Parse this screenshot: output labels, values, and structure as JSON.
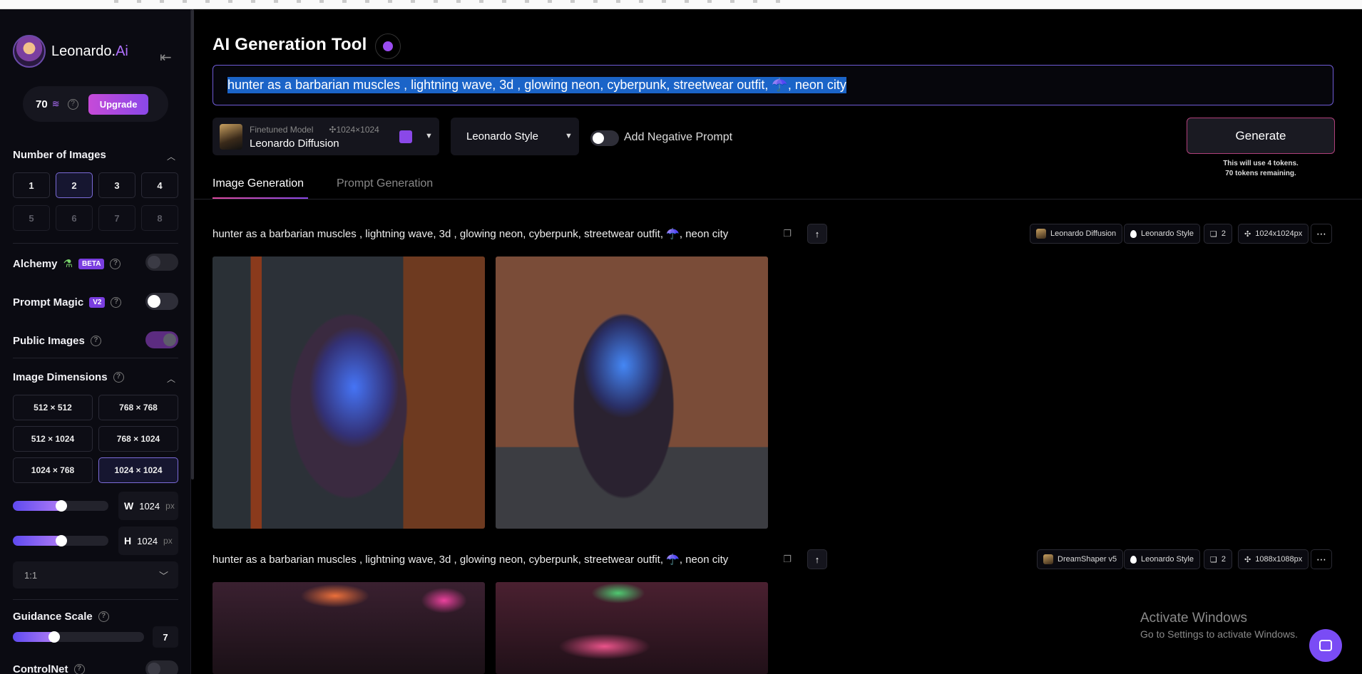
{
  "sidebar": {
    "brand_name": "Leonardo.",
    "brand_suffix": "Ai",
    "tokens": "70",
    "upgrade_label": "Upgrade",
    "number_of_images": {
      "title": "Number of Images",
      "options": [
        "1",
        "2",
        "3",
        "4",
        "5",
        "6",
        "7",
        "8"
      ],
      "selected": "2"
    },
    "alchemy": {
      "label": "Alchemy",
      "badge": "BETA",
      "enabled": false
    },
    "prompt_magic": {
      "label": "Prompt Magic",
      "badge": "V2",
      "enabled": false
    },
    "public_images": {
      "label": "Public Images",
      "enabled": true
    },
    "image_dimensions": {
      "title": "Image Dimensions",
      "options": [
        "512 × 512",
        "768 × 768",
        "512 × 1024",
        "768 × 1024",
        "1024 × 768",
        "1024 × 1024"
      ],
      "selected": "1024 × 1024",
      "width_label": "W",
      "width": "1024",
      "height_label": "H",
      "height": "1024",
      "unit": "px",
      "aspect_ratio": "1:1"
    },
    "guidance_scale": {
      "label": "Guidance Scale",
      "value": "7"
    },
    "controlnet": {
      "label": "ControlNet",
      "enabled": false
    }
  },
  "main": {
    "title": "AI Generation Tool",
    "prompt": "hunter as a barbarian muscles , lightning wave, 3d , glowing neon, cyberpunk, streetwear outfit, ☂️, neon city",
    "model": {
      "type_label": "Finetuned Model",
      "resolution": "1024×1024",
      "name": "Leonardo Diffusion"
    },
    "style": "Leonardo Style",
    "negative_prompt_label": "Add Negative Prompt",
    "generate_label": "Generate",
    "token_note_1": "This will use 4 tokens.",
    "token_note_2": "70 tokens remaining.",
    "tabs": [
      {
        "label": "Image Generation",
        "active": true
      },
      {
        "label": "Prompt Generation",
        "active": false
      }
    ],
    "generations": [
      {
        "prompt": "hunter as a barbarian muscles , lightning wave, 3d , glowing neon, cyberpunk, streetwear outfit, ☂️, neon city",
        "model": "Leonardo Diffusion",
        "style": "Leonardo Style",
        "count": "2",
        "size": "1024x1024px"
      },
      {
        "prompt": "hunter as a barbarian muscles , lightning wave, 3d , glowing neon, cyberpunk, streetwear outfit, ☂️, neon city",
        "model": "DreamShaper v5",
        "style": "Leonardo Style",
        "count": "2",
        "size": "1088x1088px"
      }
    ]
  },
  "os_overlay": {
    "line1": "Activate Windows",
    "line2": "Go to Settings to activate Windows."
  },
  "colors": {
    "accent": "#8a48e8",
    "selection": "#1b64c8",
    "generate_border": "#b0407a"
  }
}
